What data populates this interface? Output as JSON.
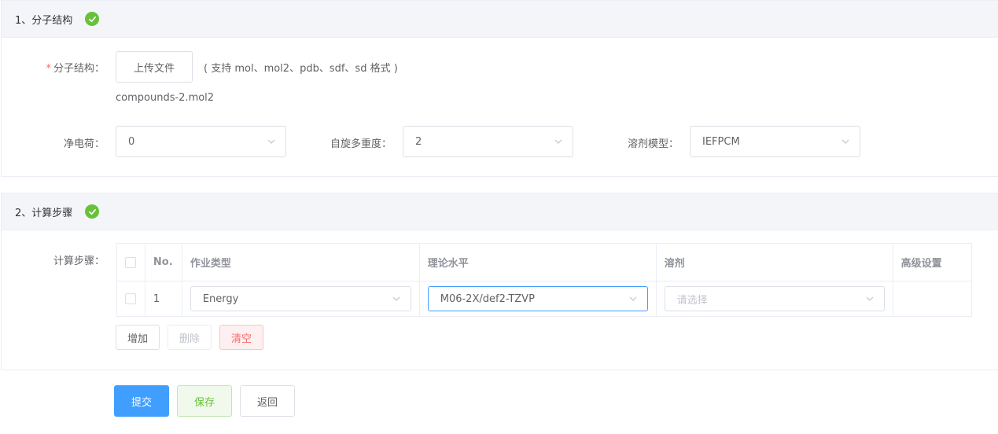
{
  "section1": {
    "title": "1、分子结构",
    "structure_label": "分子结构：",
    "upload_button": "上传文件",
    "formats_hint": "( 支持 mol、mol2、pdb、sdf、sd 格式 )",
    "filename": "compounds-2.mol2",
    "charge_label": "净电荷：",
    "charge_value": "0",
    "multiplicity_label": "自旋多重度：",
    "multiplicity_value": "2",
    "solvent_model_label": "溶剂模型：",
    "solvent_model_value": "IEFPCM"
  },
  "section2": {
    "title": "2、计算步骤",
    "steps_label": "计算步骤：",
    "columns": [
      "No.",
      "作业类型",
      "理论水平",
      "溶剂",
      "高级设置"
    ],
    "rows": [
      {
        "no": "1",
        "job_type": "Energy",
        "theory": "M06-2X/def2-TZVP",
        "solvent_placeholder": "请选择"
      }
    ],
    "add_button": "增加",
    "delete_button": "删除",
    "clear_button": "清空"
  },
  "footer": {
    "submit_button": "提交",
    "save_button": "保存",
    "back_button": "返回"
  },
  "colors": {
    "primary": "#409eff",
    "success": "#67c23a",
    "danger": "#f56c6c"
  }
}
